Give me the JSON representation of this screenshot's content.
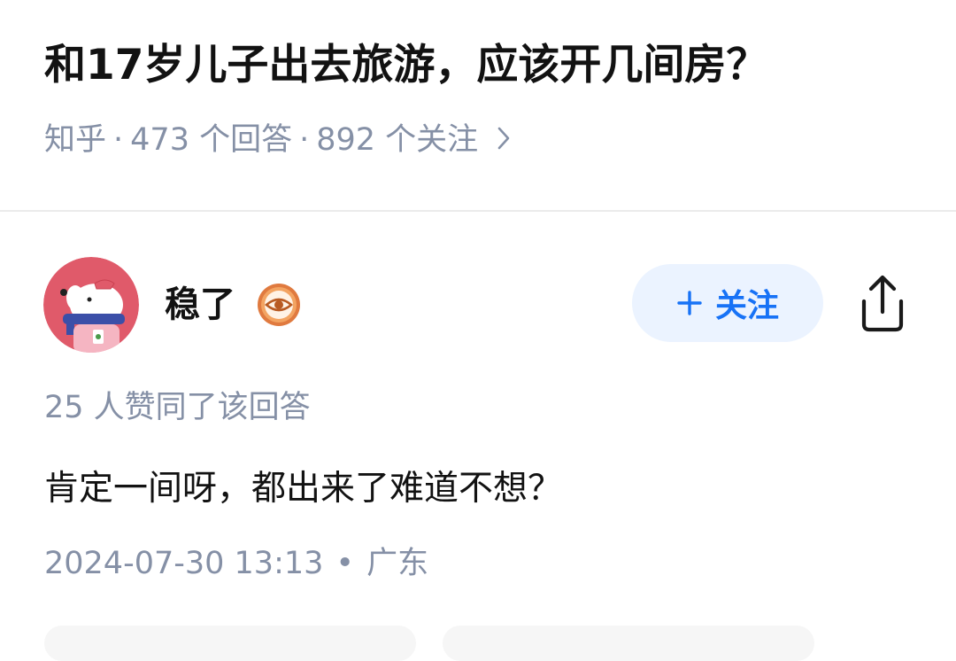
{
  "question": {
    "title": "和17岁儿子出去旅游，应该开几间房？",
    "source": "知乎",
    "answers_count": "473 个回答",
    "followers_count": "892 个关注",
    "sep": "·"
  },
  "answer": {
    "author_name": "稳了",
    "follow_label": "关注",
    "upvote_text": "25 人赞同了该回答",
    "content": "肯定一间呀，都出来了难道不想？",
    "timestamp": "2024-07-30 13:13",
    "location": "广东",
    "sep": "•"
  },
  "colors": {
    "accent": "#1772f6",
    "follow_bg": "#ebf3ff",
    "meta": "#8590a6",
    "badge": "#e07a3f",
    "avatar_bg": "#e05a6a"
  },
  "icons": [
    "chevron-right-icon",
    "plus-icon",
    "share-icon",
    "eye-badge-icon"
  ]
}
